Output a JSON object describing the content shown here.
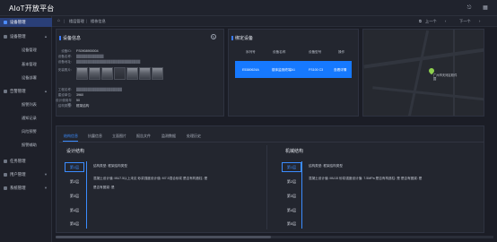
{
  "app": {
    "title": "AIoT开放平台"
  },
  "topbar": {
    "icons": [
      "logout-icon",
      "grid-icon"
    ]
  },
  "sidebar": {
    "items": [
      {
        "label": "设备管理",
        "active": true,
        "icon": "home-icon"
      },
      {
        "label": "设备管理",
        "icon": "device-icon",
        "chevron": "▲"
      },
      {
        "label": "告警管理",
        "icon": "alarm-icon",
        "chevron": "▲"
      },
      {
        "label": "任务管理",
        "icon": "task-icon"
      },
      {
        "label": "用户管理",
        "icon": "user-icon",
        "chevron": "▼"
      },
      {
        "label": "系统管理",
        "icon": "settings-icon",
        "chevron": "▼"
      }
    ],
    "device_sub": [
      "设备管理",
      "基本管理",
      "设备部署"
    ],
    "alarm_sub": [
      "报警列表",
      "通知记录",
      "风险预警",
      "报警辅助"
    ]
  },
  "breadcrumb": {
    "items": [
      "楼层管理",
      "楼栋信息"
    ],
    "back": "上一个",
    "next": "下一个"
  },
  "device_info": {
    "title": "设备信息",
    "fields": [
      {
        "label": "设备ID:",
        "value": "FS0908900004"
      },
      {
        "label": "设备名称:",
        "value": "████████████"
      },
      {
        "label": "设备地址:",
        "value": "████████████████████████████"
      },
      {
        "label": "安装照片:",
        "value": ""
      },
      {
        "label": "工程名称:",
        "value": "████████████████████"
      },
      {
        "label": "建设单位:",
        "value": "3960"
      },
      {
        "label": "设计使用年限:",
        "value": "50"
      },
      {
        "label": "结构类型:",
        "value": "框架结构"
      }
    ]
  },
  "bound_devices": {
    "title": "绑定设备",
    "headers": [
      "序列号",
      "设备名称",
      "设备型号",
      "操作"
    ],
    "rows": [
      {
        "serial": "E5380624A",
        "name": "楼体监测终端A1",
        "model": "FS100 C3",
        "action": "查看详情"
      }
    ]
  },
  "map": {
    "label": "广州市天河区软件园"
  },
  "tabs": {
    "items": [
      "结构信息",
      "抗震信息",
      "立面图片",
      "报告文件",
      "监测数据",
      "处理历史"
    ],
    "active_index": 0
  },
  "structure": {
    "title": "设计结构",
    "floors": [
      "第1层",
      "第2层",
      "第3层",
      "第4层",
      "第5层"
    ],
    "active_floor": 0,
    "line1": "结构类型:    框架结构类型",
    "line2": "混凝土设计值:    MU7.5以上未见   砂浆强度设计值:    M7.5混合砂浆  是否有构造柱:    是",
    "line3": "是否有圈梁:    是"
  },
  "mechanics": {
    "title": "机械结构",
    "floors": [
      "第1层",
      "第2层",
      "第3层",
      "第4层",
      "第5层"
    ],
    "active_floor": 0,
    "line1": "结构类型:    框架结构类型",
    "line2": "混凝土设计值:    MU15   砂浆强度设计值:    7.5MPa  是否有构造柱:    是  是否有圈梁:    是"
  },
  "colors": {
    "accent": "#3b8cff",
    "highlight_row": "#1679ff",
    "pin": "#8fd14f"
  }
}
